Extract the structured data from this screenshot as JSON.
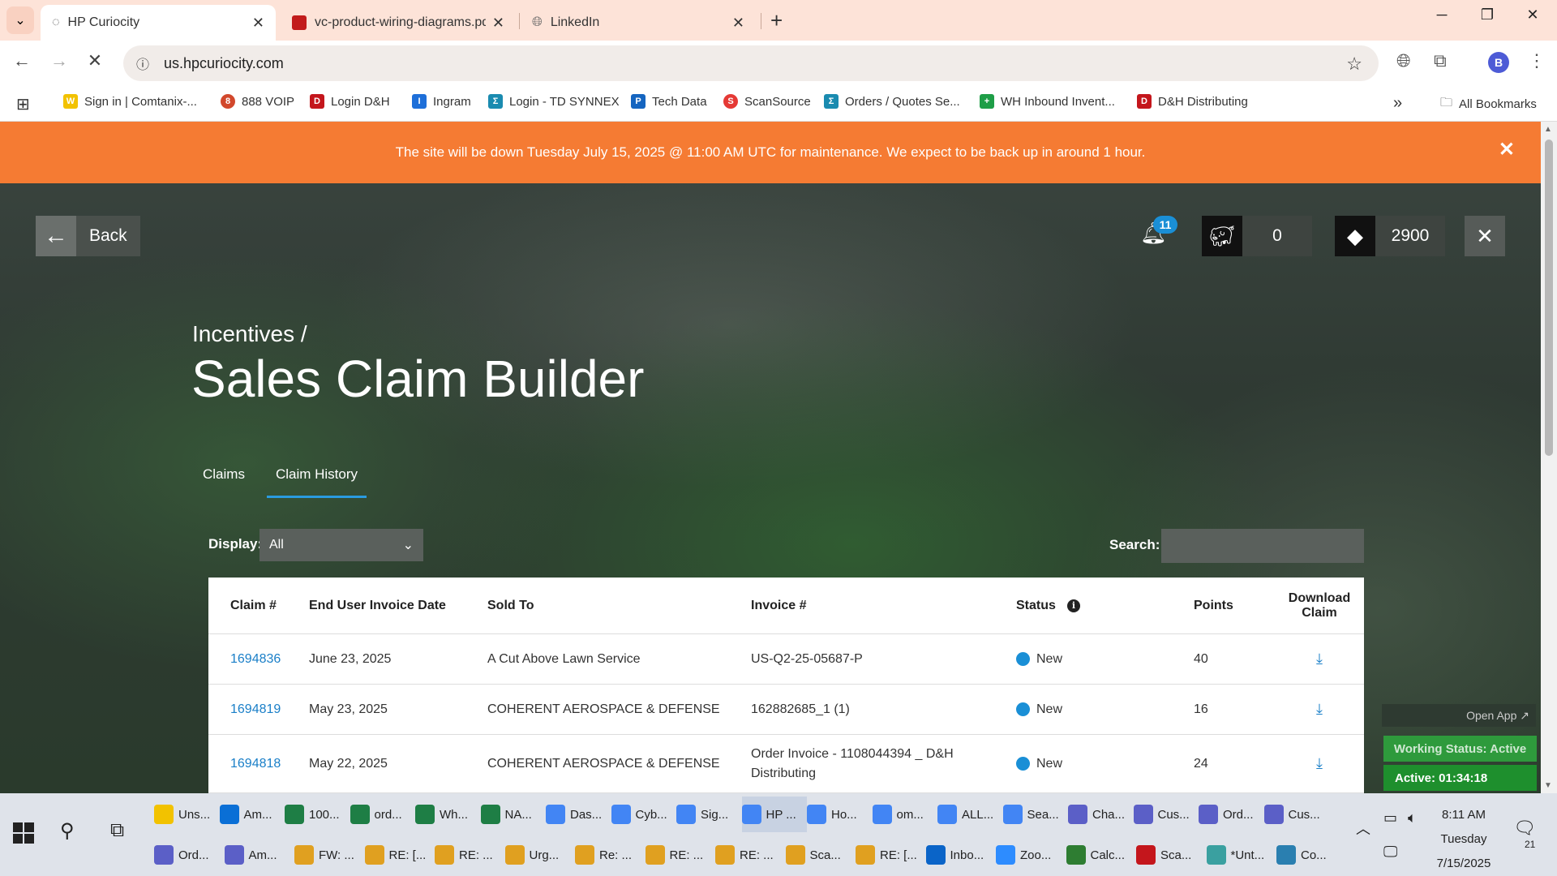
{
  "browser": {
    "tabs": [
      {
        "title": "HP Curiocity",
        "active": true
      },
      {
        "title": "vc-product-wiring-diagrams.pd",
        "active": false
      },
      {
        "title": "LinkedIn",
        "active": false
      }
    ],
    "url": "us.hpcuriocity.com",
    "bookmarks": [
      "Sign in | Comtanix-...",
      "888 VOIP",
      "Login D&H",
      "Ingram",
      "Login - TD SYNNEX",
      "Tech Data",
      "ScanSource",
      "Orders / Quotes Se...",
      "WH Inbound Invent...",
      "D&H Distributing"
    ],
    "all_bookmarks": "All Bookmarks",
    "profile_initial": "B"
  },
  "banner": {
    "text": "The site will be down Tuesday July 15, 2025 @ 11:00 AM UTC for maintenance. We expect to be back up in around 1 hour."
  },
  "header": {
    "back_label": "Back",
    "notification_count": "11",
    "piggy_points": "0",
    "diamond_points": "2900"
  },
  "page": {
    "breadcrumb": "Incentives /",
    "title": "Sales Claim Builder",
    "tabs": [
      "Claims",
      "Claim History"
    ],
    "display_label": "Display:",
    "display_value": "All",
    "search_label": "Search:"
  },
  "table": {
    "headers": [
      "Claim #",
      "End User Invoice Date",
      "Sold To",
      "Invoice #",
      "Status",
      "Points",
      "Download Claim"
    ],
    "rows": [
      {
        "claim": "1694836",
        "date": "June 23, 2025",
        "sold_to": "A Cut Above Lawn Service",
        "invoice": "US-Q2-25-05687-P",
        "status": "New",
        "points": "40"
      },
      {
        "claim": "1694819",
        "date": "May 23, 2025",
        "sold_to": "COHERENT AEROSPACE & DEFENSE",
        "invoice": "162882685_1 (1)",
        "status": "New",
        "points": "16"
      },
      {
        "claim": "1694818",
        "date": "May 22, 2025",
        "sold_to": "COHERENT AEROSPACE & DEFENSE",
        "invoice": "Order Invoice - 1108044394 _ D&H Distributing",
        "status": "New",
        "points": "24"
      }
    ]
  },
  "widget": {
    "open_app": "Open App ↗",
    "working_status": "Working Status: Active",
    "active_timer": "Active: 01:34:18"
  },
  "taskbar": {
    "row1": [
      "Uns...",
      "Am...",
      "100...",
      "ord...",
      "Wh...",
      "NA...",
      "Das...",
      "Cyb...",
      "Sig...",
      "HP ...",
      "Ho...",
      "om...",
      "ALL...",
      "Sea...",
      "Cha...",
      "Cus...",
      "Ord...",
      "Cus..."
    ],
    "row2": [
      "Ord...",
      "Am...",
      "FW: ...",
      "RE: [...",
      "RE: ...",
      "Urg...",
      "Re: ...",
      "RE: ...",
      "RE: ...",
      "Sca...",
      "RE: [...",
      "Inbo...",
      "Zoo...",
      "Calc...",
      "Sca...",
      "*Unt...",
      "Co..."
    ],
    "time": "8:11 AM",
    "day": "Tuesday",
    "date": "7/15/2025",
    "notification_count": "21"
  },
  "colors": {
    "banner": "#f57b33",
    "accent": "#1a8fd6",
    "tab_strip": "#fde3d8"
  }
}
